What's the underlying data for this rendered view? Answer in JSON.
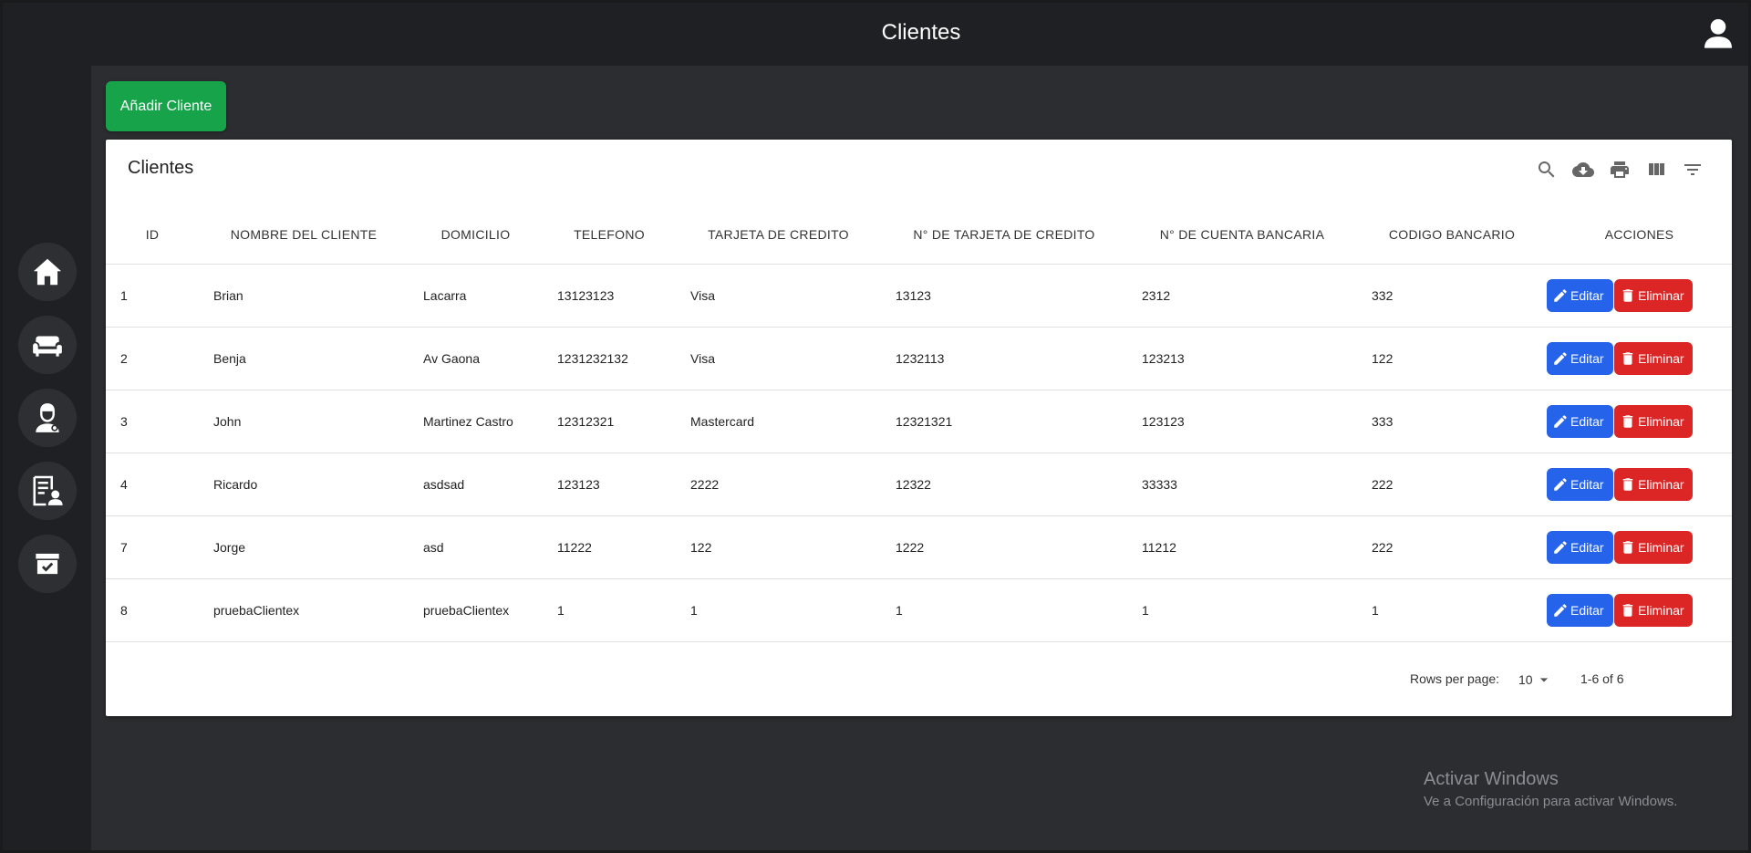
{
  "header": {
    "title": "Clientes"
  },
  "actions": {
    "add_label": "Añadir Cliente"
  },
  "table": {
    "title": "Clientes",
    "columns": [
      "ID",
      "NOMBRE DEL CLIENTE",
      "DOMICILIO",
      "TELEFONO",
      "TARJETA DE CREDITO",
      "N° DE TARJETA DE CREDITO",
      "N° DE CUENTA BANCARIA",
      "CODIGO BANCARIO",
      "ACCIONES"
    ],
    "rows": [
      [
        "1",
        "Brian",
        "Lacarra",
        "13123123",
        "Visa",
        "13123",
        "2312",
        "332"
      ],
      [
        "2",
        "Benja",
        "Av Gaona",
        "1231232132",
        "Visa",
        "1232113",
        "123213",
        "122"
      ],
      [
        "3",
        "John",
        "Martinez Castro",
        "12312321",
        "Mastercard",
        "12321321",
        "123123",
        "333"
      ],
      [
        "4",
        "Ricardo",
        "asdsad",
        "123123",
        "2222",
        "12322",
        "33333",
        "222"
      ],
      [
        "7",
        "Jorge",
        "asd",
        "11222",
        "122",
        "1222",
        "11212",
        "222"
      ],
      [
        "8",
        "pruebaClientex",
        "pruebaClientex",
        "1",
        "1",
        "1",
        "1",
        "1"
      ]
    ],
    "edit_label": "Editar",
    "delete_label": "Eliminar"
  },
  "pagination": {
    "rows_per_page_label": "Rows per page:",
    "rows_per_page": "10",
    "range": "1-6 of 6"
  },
  "watermark": {
    "title": "Activar Windows",
    "subtitle": "Ve a Configuración para activar Windows."
  },
  "icons": {
    "sidebar": [
      "home-icon",
      "sofa-icon",
      "employee-icon",
      "client-list-icon",
      "archive-check-icon"
    ],
    "toolbar": [
      "search-icon",
      "download-icon",
      "print-icon",
      "columns-icon",
      "filter-icon"
    ]
  },
  "colors": {
    "add": "#16a34a",
    "edit": "#2563eb",
    "delete": "#dc2626",
    "sidebar": "#1f2023"
  }
}
